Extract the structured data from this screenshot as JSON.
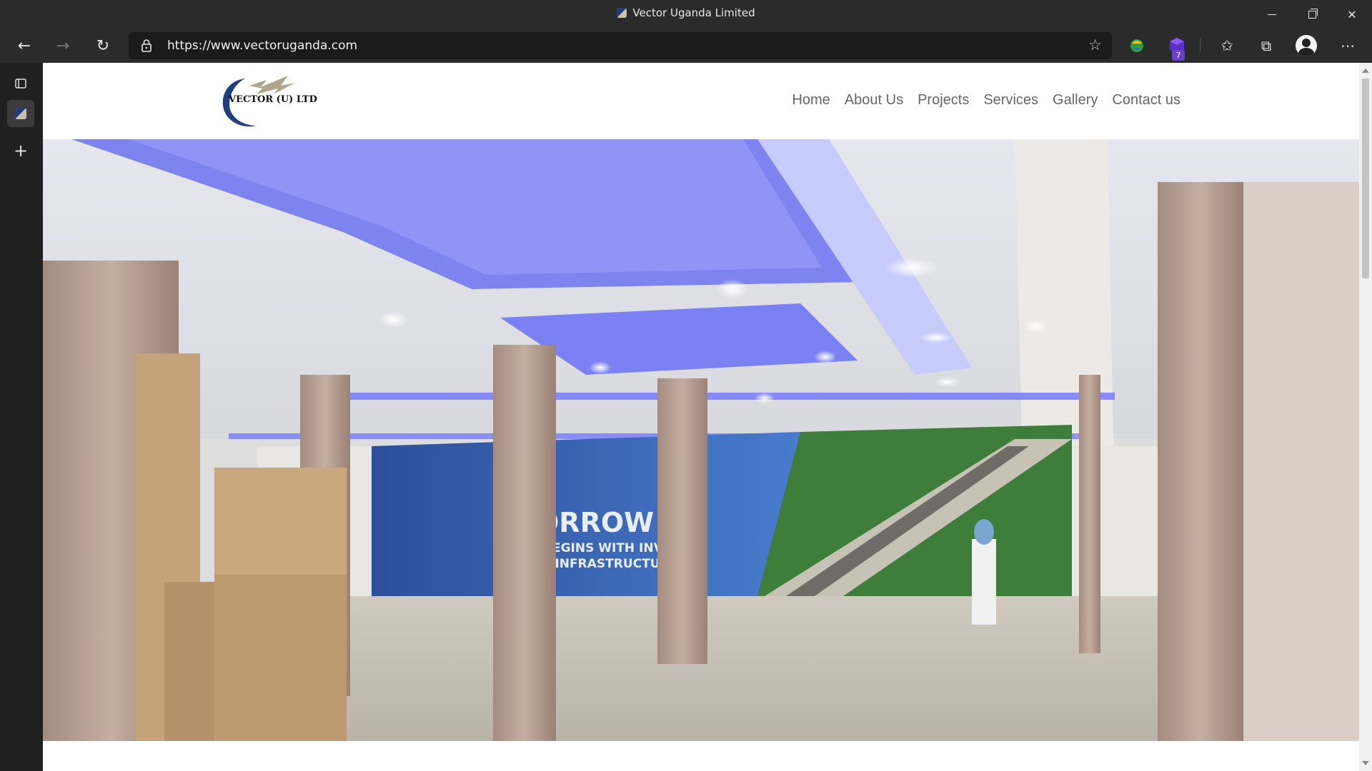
{
  "window": {
    "title": "Vector Uganda Limited"
  },
  "toolbar": {
    "url": "https://www.vectoruganda.com",
    "extension_badge": "7"
  },
  "site": {
    "logo_text": "VECTOR (U) LTD",
    "nav": [
      "Home",
      "About Us",
      "Projects",
      "Services",
      "Gallery",
      "Contact us"
    ]
  },
  "hero": {
    "wall_text_1": "ORROW",
    "wall_text_2": "BEGINS WITH INV",
    "wall_text_3": "IN INFRASTRUCTU"
  },
  "colors": {
    "brand_blue": "#1f3e7a",
    "nav_text": "#666666",
    "ceiling_glow": "#6b6cff"
  }
}
